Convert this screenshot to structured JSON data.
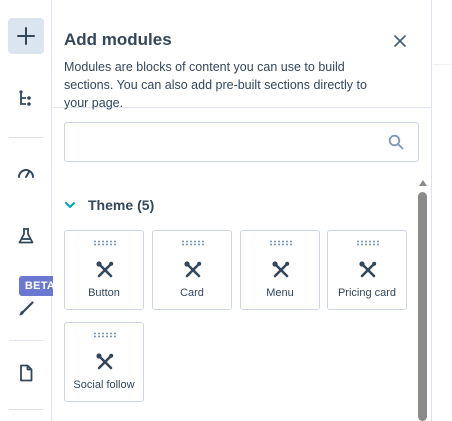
{
  "rail": {
    "items": [
      {
        "name": "add-icon",
        "active": true
      },
      {
        "name": "layers-tree-icon",
        "active": false
      },
      {
        "name": "gauge-icon",
        "active": false
      },
      {
        "name": "beaker-icon",
        "active": false
      },
      {
        "name": "brush-icon",
        "active": false
      },
      {
        "name": "document-icon",
        "active": false
      }
    ],
    "beta_badge": "BETA"
  },
  "panel": {
    "title": "Add modules",
    "description": "Modules are blocks of content you can use to build sections. You can also add pre-built sections directly to your page.",
    "search": {
      "value": "",
      "placeholder": ""
    },
    "section": {
      "label": "Theme",
      "count": "(5)",
      "expanded": true
    },
    "modules": [
      {
        "label": "Button",
        "icon": "wrench-screwdriver-icon"
      },
      {
        "label": "Card",
        "icon": "wrench-screwdriver-icon"
      },
      {
        "label": "Menu",
        "icon": "wrench-screwdriver-icon"
      },
      {
        "label": "Pricing card",
        "icon": "wrench-screwdriver-icon"
      },
      {
        "label": "Social follow",
        "icon": "wrench-screwdriver-icon"
      }
    ]
  },
  "colors": {
    "text": "#33475b",
    "accent_teal": "#00a4bd",
    "active_rail_bg": "#dbe5f0",
    "beta_badge": "#6a78d1",
    "border": "#cbd6e2"
  }
}
